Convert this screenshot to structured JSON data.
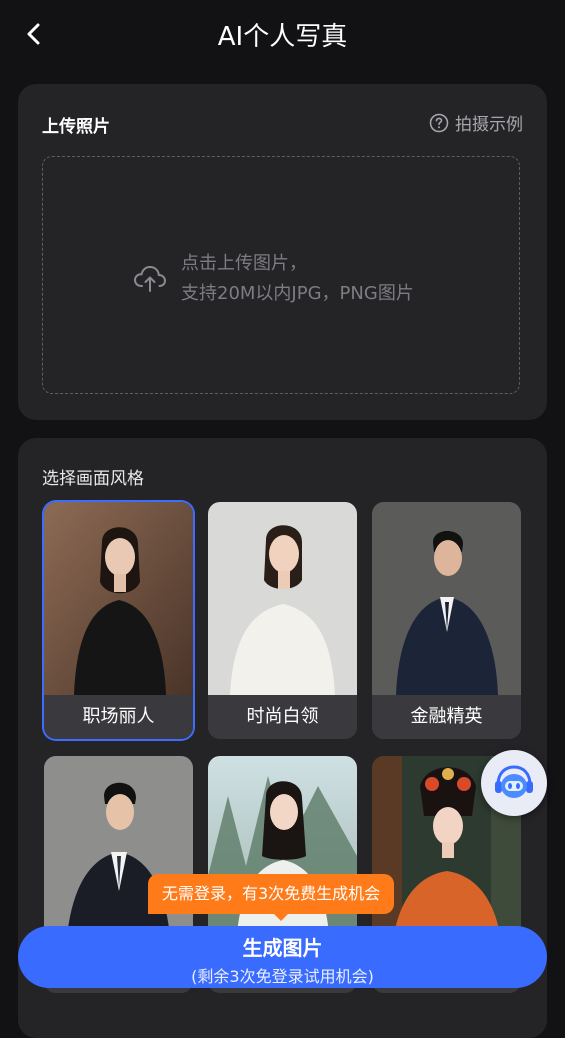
{
  "header": {
    "title": "AI个人写真"
  },
  "upload": {
    "title": "上传照片",
    "example_link": "拍摄示例",
    "drop_line1": "点击上传图片，",
    "drop_line2": "支持20M以内JPG，PNG图片"
  },
  "styles": {
    "title": "选择画面风格",
    "items": [
      {
        "label": "职场丽人",
        "selected": true
      },
      {
        "label": "时尚白领",
        "selected": false
      },
      {
        "label": "金融精英",
        "selected": false
      },
      {
        "label": "",
        "selected": false
      },
      {
        "label": "",
        "selected": false
      },
      {
        "label": "",
        "selected": false
      }
    ]
  },
  "promo_tip": "无需登录，有3次免费生成机会",
  "generate": {
    "label": "生成图片",
    "sub_label": "(剩余3次免登录试用机会)"
  },
  "colors": {
    "accent": "#3a6bff",
    "promo": "#ff7a18",
    "background": "#121214",
    "card": "#242427"
  }
}
